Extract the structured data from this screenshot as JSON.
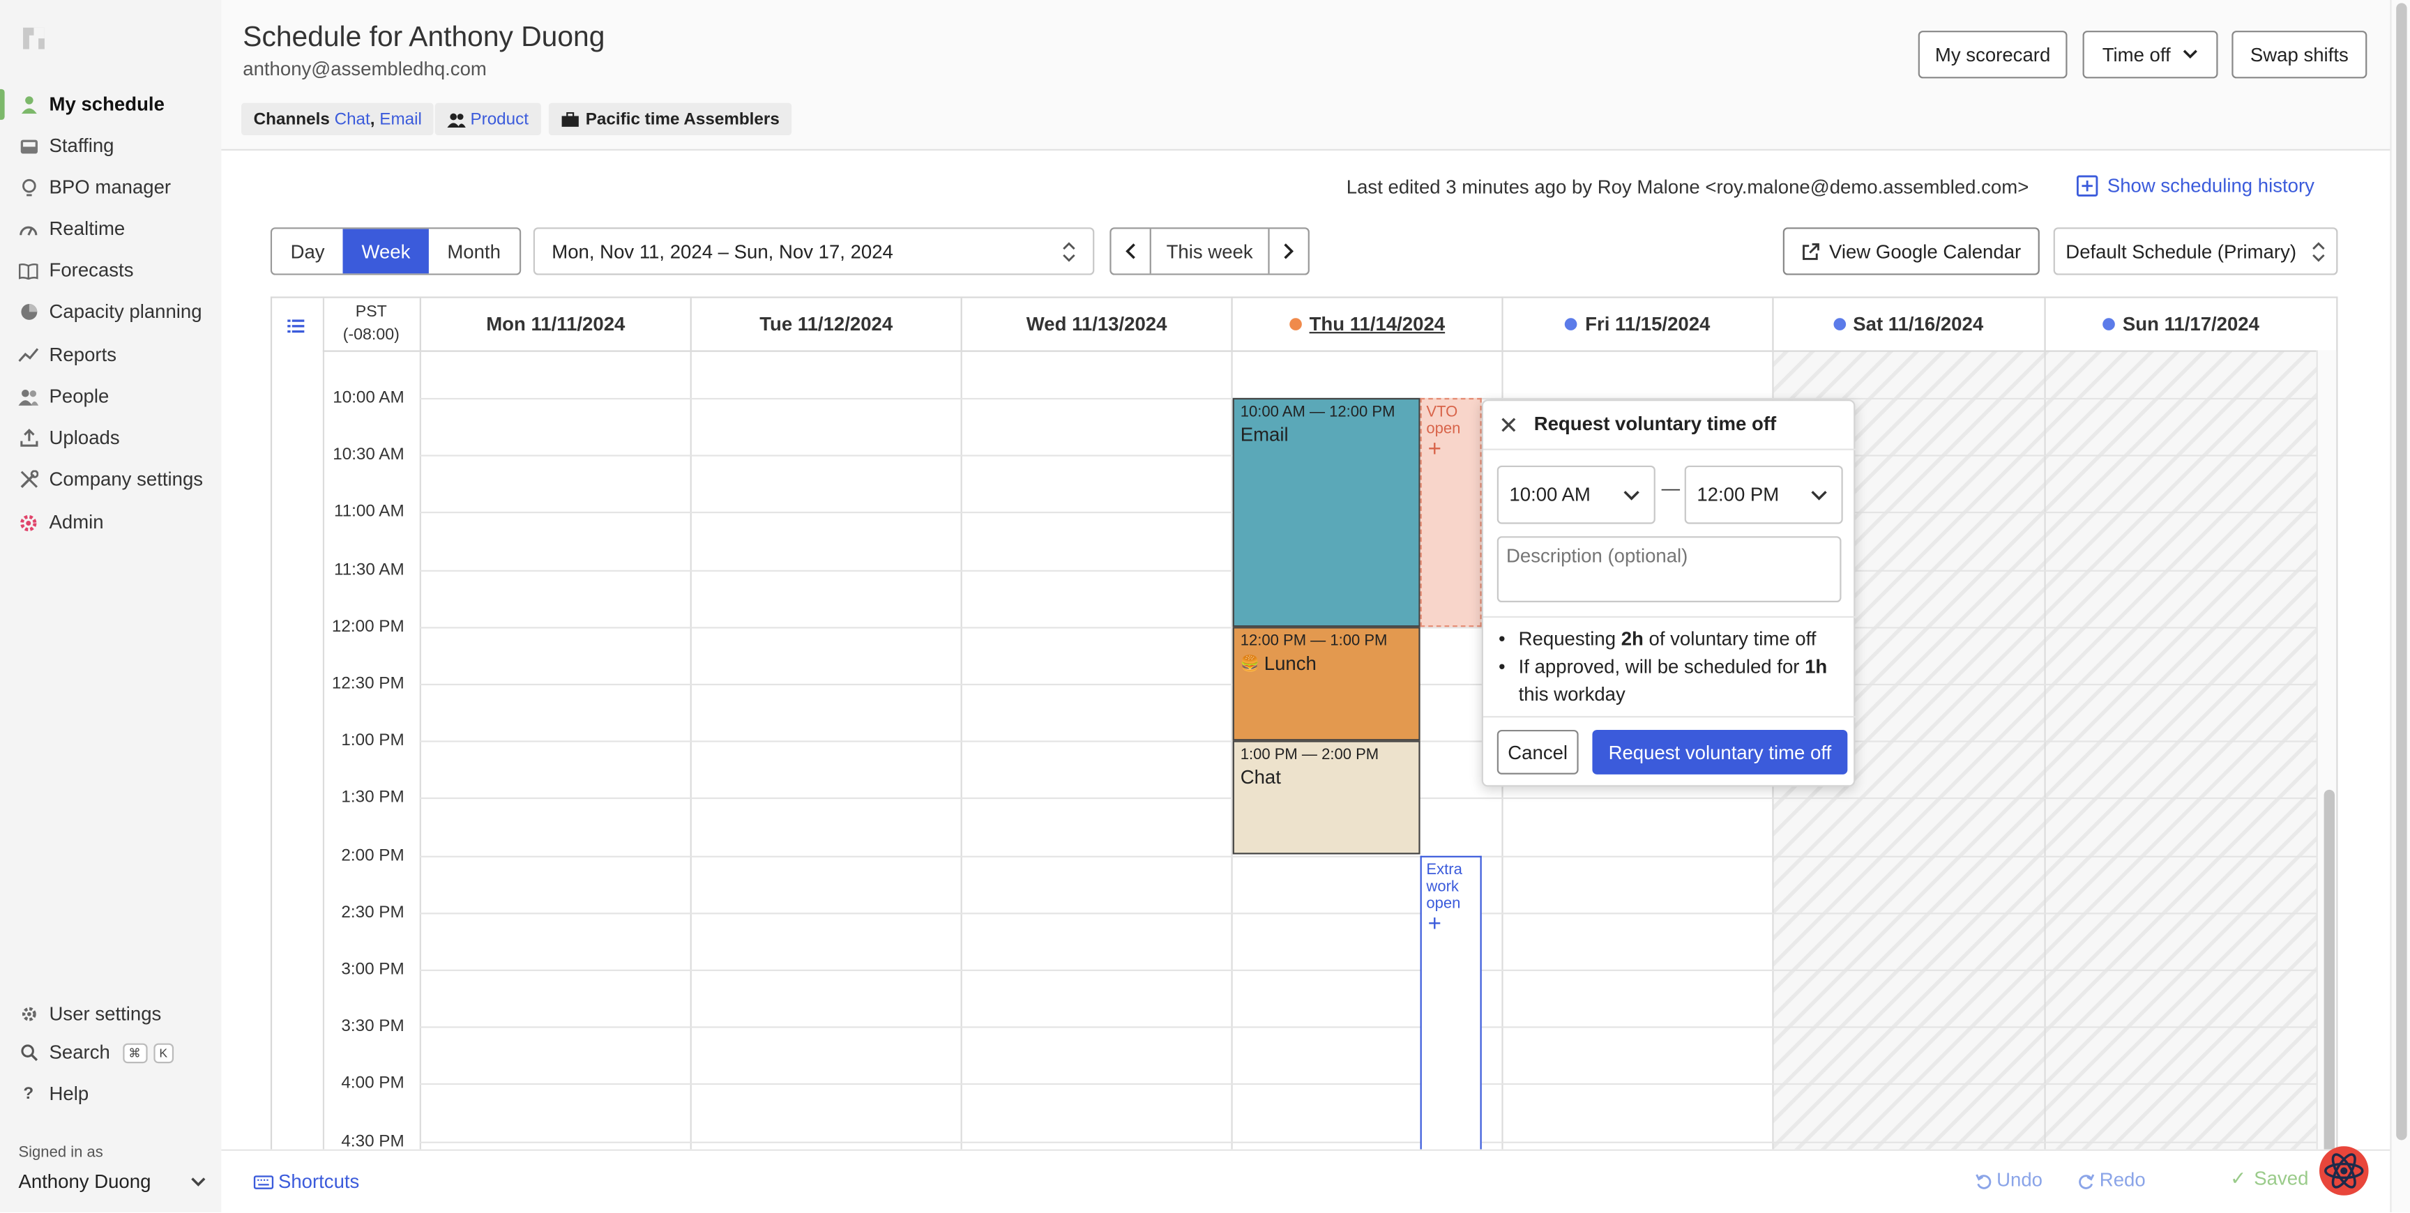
{
  "sidebar": {
    "items": [
      {
        "label": "My schedule",
        "icon": "person-icon"
      },
      {
        "label": "Staffing",
        "icon": "inbox-icon"
      },
      {
        "label": "BPO manager",
        "icon": "lightbulb-icon"
      },
      {
        "label": "Realtime",
        "icon": "gauge-icon"
      },
      {
        "label": "Forecasts",
        "icon": "book-icon"
      },
      {
        "label": "Capacity planning",
        "icon": "pie-icon"
      },
      {
        "label": "Reports",
        "icon": "trend-icon"
      },
      {
        "label": "People",
        "icon": "people-icon"
      },
      {
        "label": "Uploads",
        "icon": "upload-icon"
      },
      {
        "label": "Company settings",
        "icon": "tools-icon"
      },
      {
        "label": "Admin",
        "icon": "gear-red-icon"
      }
    ],
    "bottom": {
      "user_settings": "User settings",
      "search": "Search",
      "kbd_cmd": "⌘",
      "kbd_k": "K",
      "help": "Help",
      "signed_in_as": "Signed in as",
      "user_name": "Anthony Duong"
    }
  },
  "header": {
    "title": "Schedule for Anthony Duong",
    "email": "anthony@assembledhq.com",
    "channels_label": "Channels",
    "channel_1": "Chat",
    "channel_sep": ",",
    "channel_2": "Email",
    "team_tag": "Product",
    "site_tag": "Pacific time Assemblers",
    "btn_scorecard": "My scorecard",
    "btn_timeoff": "Time off",
    "btn_swap": "Swap shifts"
  },
  "toolbar": {
    "last_edited": "Last edited 3 minutes ago by Roy Malone <roy.malone@demo.assembled.com>",
    "show_history": "Show scheduling history",
    "view_tabs": [
      "Day",
      "Week",
      "Month"
    ],
    "active_view": "Week",
    "date_range": "Mon, Nov 11, 2024 – Sun, Nov 17, 2024",
    "this_week": "This week",
    "google_cal": "View Google Calendar",
    "schedule_select": "Default Schedule (Primary)"
  },
  "calendar": {
    "tz_line1": "PST",
    "tz_line2": "(-08:00)",
    "days": [
      {
        "label": "Mon 11/11/2024",
        "dot": ""
      },
      {
        "label": "Tue 11/12/2024",
        "dot": ""
      },
      {
        "label": "Wed 11/13/2024",
        "dot": ""
      },
      {
        "label": "Thu 11/14/2024",
        "dot": "#f08a4b"
      },
      {
        "label": "Fri 11/15/2024",
        "dot": "#5b7be9"
      },
      {
        "label": "Sat 11/16/2024",
        "dot": "#5b7be9"
      },
      {
        "label": "Sun 11/17/2024",
        "dot": "#5b7be9"
      }
    ],
    "times": [
      "10:00 AM",
      "10:30 AM",
      "11:00 AM",
      "11:30 AM",
      "12:00 PM",
      "12:30 PM",
      "1:00 PM",
      "1:30 PM",
      "2:00 PM",
      "2:30 PM",
      "3:00 PM",
      "3:30 PM",
      "4:00 PM",
      "4:30 PM"
    ],
    "events": {
      "email": {
        "time": "10:00 AM — 12:00 PM",
        "name": "Email",
        "color": "#5ba8b8"
      },
      "lunch": {
        "time": "12:00 PM — 1:00 PM",
        "name": "Lunch",
        "color": "#e3994f"
      },
      "chat": {
        "time": "1:00 PM — 2:00 PM",
        "name": "Chat",
        "color": "#ede2cc"
      }
    },
    "vto": {
      "line1": "VTO",
      "line2": "open",
      "plus": "+"
    },
    "extra": {
      "line1": "Extra",
      "line2": "work",
      "line3": "open",
      "plus": "+"
    }
  },
  "popup": {
    "title": "Request voluntary time off",
    "start": "10:00 AM",
    "dash": "—",
    "end": "12:00 PM",
    "description_placeholder": "Description (optional)",
    "b1_pre": "Requesting ",
    "b1_bold": "2h",
    "b1_post": " of voluntary time off",
    "b2_pre": "If approved, will be scheduled for ",
    "b2_bold": "1h",
    "b2_post": "this workday",
    "cancel": "Cancel",
    "submit": "Request voluntary time off"
  },
  "footer": {
    "shortcuts": "Shortcuts",
    "undo": "Undo",
    "redo": "Redo",
    "saved": "Saved"
  },
  "colors": {
    "accent": "#3b5bdb",
    "active_nav": "#7cb86a"
  }
}
